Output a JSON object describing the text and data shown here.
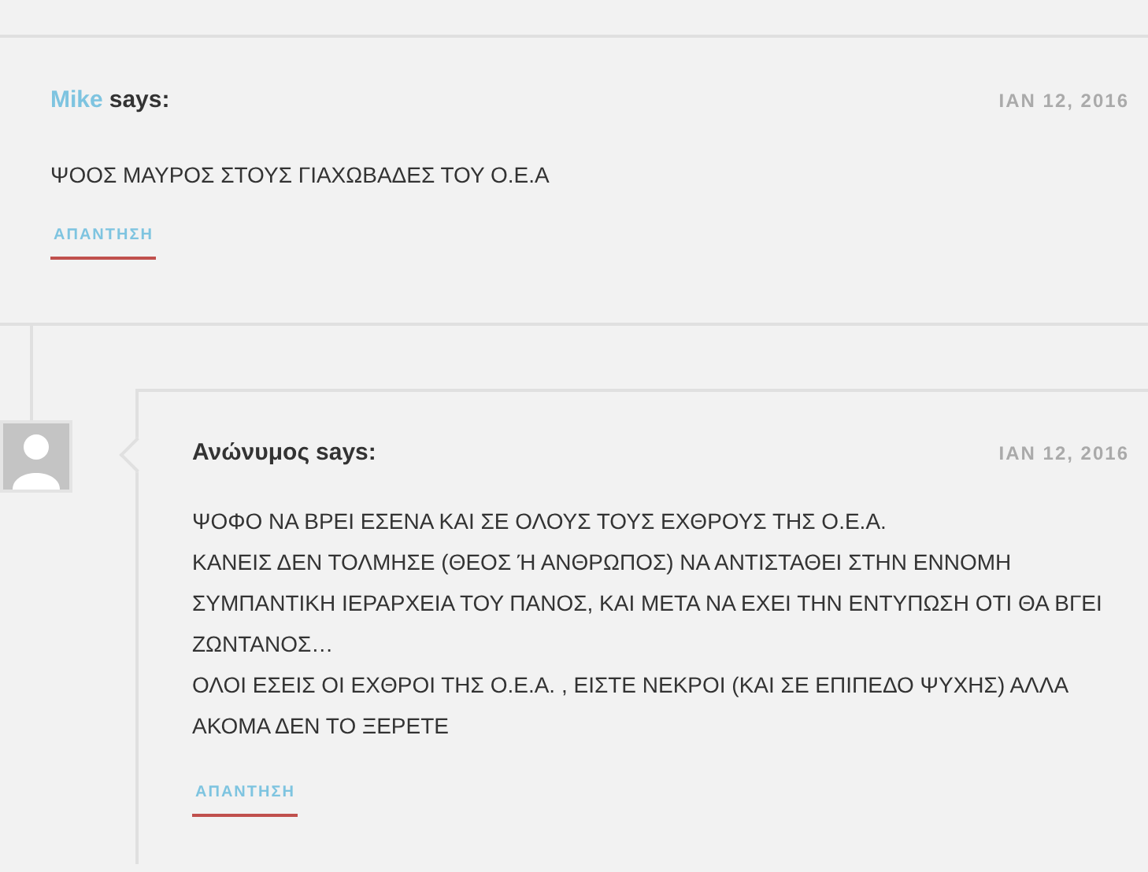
{
  "comments": [
    {
      "author": "Mike",
      "author_linked": true,
      "says": "says:",
      "date": "ΙΑΝ 12, 2016",
      "paragraphs": [
        "ΨΟΟΣ ΜΑΥΡΟΣ ΣΤΟΥΣ ΓΙΑΧΩΒΑΔΕΣ ΤΟΥ Ο.Ε.Α"
      ],
      "reply": "ΑΠΑΝΤΗΣΗ",
      "children": [
        {
          "author": "Ανώνυμος",
          "author_linked": false,
          "says": "says:",
          "date": "ΙΑΝ 12, 2016",
          "paragraphs": [
            "ΨΟΦΟ ΝΑ ΒΡΕΙ ΕΣΕΝΑ ΚΑΙ ΣΕ ΟΛΟΥΣ ΤΟΥΣ ΕΧΘΡΟΥΣ ΤΗΣ Ο.Ε.Α.",
            "ΚΑΝΕΙΣ ΔΕΝ ΤΟΛΜΗΣΕ (ΘΕΟΣ Ή ΑΝΘΡΩΠΟΣ) ΝΑ ΑΝΤΙΣΤΑΘΕΙ ΣΤΗΝ ΕΝΝΟΜΗ ΣΥΜΠΑΝΤΙΚΗ ΙΕΡΑΡΧΕΙΑ ΤΟΥ ΠΑΝΟΣ, ΚΑΙ ΜΕΤΑ ΝΑ ΕΧΕΙ ΤΗΝ ΕΝΤΥΠΩΣΗ ΟΤΙ ΘΑ ΒΓΕΙ ΖΩΝΤΑΝΟΣ…",
            "ΟΛΟΙ ΕΣΕΙΣ ΟΙ ΕΧΘΡΟΙ ΤΗΣ Ο.Ε.Α. , ΕΙΣΤΕ ΝΕΚΡΟΙ (ΚΑΙ ΣΕ ΕΠΙΠΕΔΟ ΨΥΧΗΣ) ΑΛΛΑ ΑΚΟΜΑ ΔΕΝ ΤΟ ΞΕΡΕΤΕ"
          ],
          "reply": "ΑΠΑΝΤΗΣΗ"
        }
      ]
    }
  ]
}
